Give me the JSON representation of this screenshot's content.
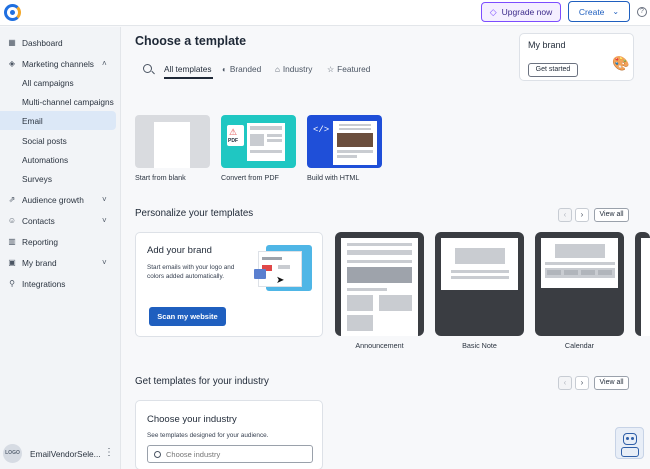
{
  "header": {
    "upgrade_label": "Upgrade now",
    "create_label": "Create"
  },
  "sidebar": {
    "items": [
      {
        "label": "Dashboard"
      },
      {
        "label": "Marketing channels"
      },
      {
        "label": "All campaigns"
      },
      {
        "label": "Multi-channel campaigns"
      },
      {
        "label": "Email"
      },
      {
        "label": "Social posts"
      },
      {
        "label": "Automations"
      },
      {
        "label": "Surveys"
      },
      {
        "label": "Audience growth"
      },
      {
        "label": "Contacts"
      },
      {
        "label": "Reporting"
      },
      {
        "label": "My brand"
      },
      {
        "label": "Integrations"
      }
    ],
    "footer": {
      "logo_text": "LOGO",
      "account_name": "EmailVendorSele..."
    }
  },
  "main": {
    "title": "Choose a template",
    "tabs": [
      {
        "label": "All templates"
      },
      {
        "label": "Branded"
      },
      {
        "label": "Industry"
      },
      {
        "label": "Featured"
      }
    ],
    "my_brand": {
      "title": "My brand",
      "button": "Get started"
    },
    "start_options": [
      {
        "label": "Start from blank"
      },
      {
        "label": "Convert from PDF",
        "badge": "PDF"
      },
      {
        "label": "Build with HTML",
        "badge": "</>"
      }
    ],
    "personalize": {
      "title": "Personalize your templates",
      "view_all": "View all",
      "add_brand_title": "Add your brand",
      "add_brand_desc": "Start emails with your logo and colors added automatically.",
      "scan_button": "Scan my website",
      "templates": [
        {
          "label": "Announcement"
        },
        {
          "label": "Basic Note"
        },
        {
          "label": "Calendar"
        }
      ]
    },
    "industry": {
      "title": "Get templates for your industry",
      "view_all": "View all",
      "card_title": "Choose your industry",
      "card_desc": "See templates designed for your audience.",
      "input_placeholder": "Choose industry"
    }
  },
  "colors": {
    "primary": "#1f5fbf",
    "upgrade_accent": "#7c4dff",
    "active_nav": "#dce8f7",
    "pdf_tile": "#1fc7c2",
    "html_tile": "#1f4fd8"
  }
}
